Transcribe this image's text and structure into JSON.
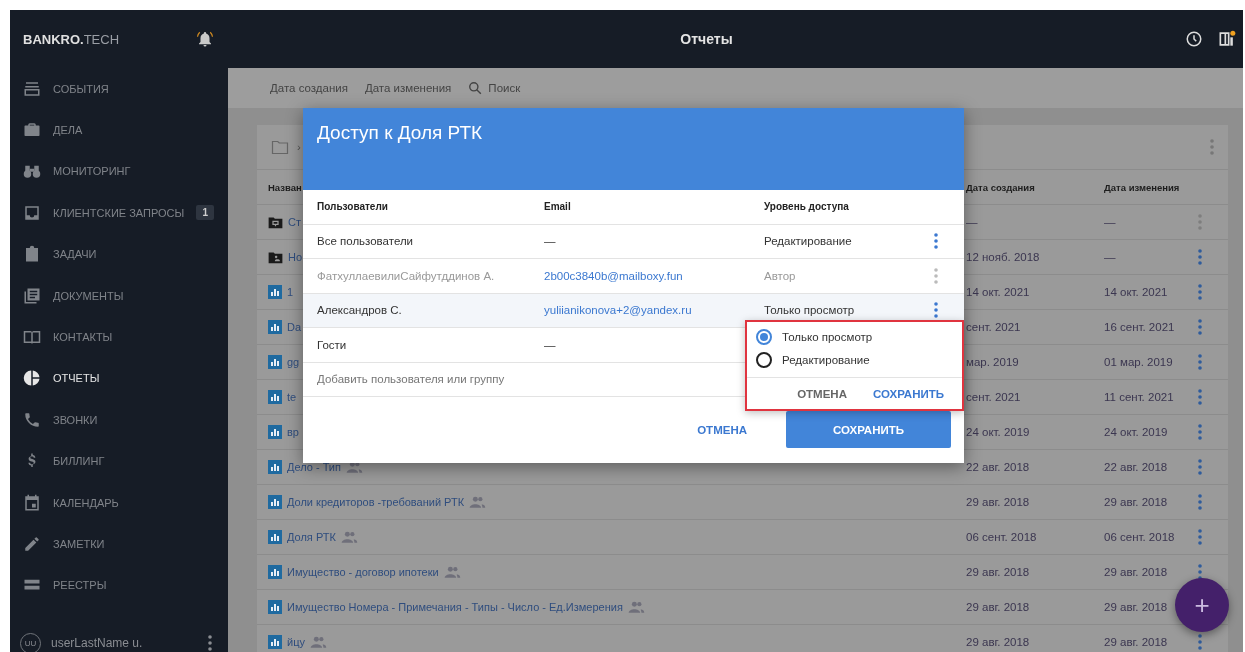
{
  "app": {
    "logo": "**BANKRO.**TECH",
    "title": "Отчеты"
  },
  "sidebar": {
    "items": [
      {
        "kind": "events",
        "label": "СОБЫТИЯ",
        "selected": false
      },
      {
        "kind": "cases",
        "label": "ДЕЛА",
        "selected": false
      },
      {
        "kind": "monitoring",
        "label": "МОНИТОРИНГ",
        "selected": false
      },
      {
        "kind": "inbox",
        "label": "КЛИЕНТСКИЕ ЗАПРОСЫ",
        "badge": "1",
        "selected": false
      },
      {
        "kind": "tasks",
        "label": "ЗАДАЧИ",
        "selected": false
      },
      {
        "kind": "documents",
        "label": "ДОКУМЕНТЫ",
        "selected": false
      },
      {
        "kind": "contacts",
        "label": "КОНТАКТЫ",
        "selected": false
      },
      {
        "kind": "reports",
        "label": "ОТЧЕТЫ",
        "selected": true
      },
      {
        "kind": "calls",
        "label": "ЗВОНКИ",
        "selected": false
      },
      {
        "kind": "billing",
        "label": "БИЛЛИНГ",
        "selected": false
      },
      {
        "kind": "calendar",
        "label": "КАЛЕНДАРЬ",
        "selected": false
      },
      {
        "kind": "notes",
        "label": "ЗАМЕТКИ",
        "selected": false
      },
      {
        "kind": "registers",
        "label": "РЕЕСТРЫ",
        "selected": false
      }
    ],
    "user": {
      "initials": "UU",
      "name": "userLastName u."
    }
  },
  "toolbar": {
    "sort_options": [
      "Дата создания",
      "Дата изменения"
    ],
    "search": "Поиск"
  },
  "breadcrumb": {
    "separator": "›"
  },
  "table": {
    "columns": [
      "Назван",
      "Дата создания",
      "Дата изменения"
    ],
    "rows": [
      {
        "kind": "folder-desktop",
        "name": "Ст",
        "shared": false,
        "created": "—",
        "modified": "—",
        "actions_disabled": true
      },
      {
        "kind": "folder-person",
        "name": "Но",
        "shared": false,
        "created": "12 нояб. 2018",
        "modified": "—",
        "actions_disabled": false
      },
      {
        "kind": "report",
        "name": "1",
        "shared": false,
        "created": "14 окт. 2021",
        "modified": "14 окт. 2021",
        "actions_disabled": false
      },
      {
        "kind": "report",
        "name": "Da",
        "shared": false,
        "created": "сент. 2021",
        "modified": "16 сент. 2021",
        "actions_disabled": false
      },
      {
        "kind": "report",
        "name": "gg",
        "shared": false,
        "created": "мар. 2019",
        "modified": "01 мар. 2019",
        "actions_disabled": false
      },
      {
        "kind": "report",
        "name": "te",
        "shared": false,
        "created": "сент. 2021",
        "modified": "11 сент. 2021",
        "actions_disabled": false
      },
      {
        "kind": "report",
        "name": "вр",
        "shared": false,
        "created": "24 окт. 2019",
        "modified": "24 окт. 2019",
        "actions_disabled": false
      },
      {
        "kind": "report",
        "name": "Дело - Тип",
        "shared": true,
        "created": "22 авг. 2018",
        "modified": "22 авг. 2018",
        "actions_disabled": false
      },
      {
        "kind": "report",
        "name": "Доли кредиторов -требований РТК",
        "shared": true,
        "created": "29 авг. 2018",
        "modified": "29 авг. 2018",
        "actions_disabled": false
      },
      {
        "kind": "report",
        "name": "Доля РТК",
        "shared": true,
        "created": "06 сент. 2018",
        "modified": "06 сент. 2018",
        "actions_disabled": false
      },
      {
        "kind": "report",
        "name": "Имущество - договор ипотеки",
        "shared": true,
        "created": "29 авг. 2018",
        "modified": "29 авг. 2018",
        "actions_disabled": false
      },
      {
        "kind": "report",
        "name": "Имущество Номера - Примечания - Типы - Число - Ед.Измерения",
        "shared": true,
        "created": "29 авг. 2018",
        "modified": "29 авг. 2018",
        "actions_disabled": false
      },
      {
        "kind": "report",
        "name": "йцу",
        "shared": true,
        "created": "29 авг. 2018",
        "modified": "29 авг. 2018",
        "actions_disabled": false
      }
    ]
  },
  "dialog": {
    "title": "Доступ к Доля РТК",
    "columns": [
      "Пользователи",
      "Email",
      "Уровень доступа"
    ],
    "rows": [
      {
        "kind": "group",
        "user": "Все пользователи",
        "email": "—",
        "level": "Редактирование",
        "disabled": false,
        "selected": false
      },
      {
        "kind": "user",
        "user": "ФатхуллаевилиСайфутддинов А.",
        "email": "2b00c3840b@mailboxy.fun",
        "level": "Автор",
        "disabled": true,
        "selected": false
      },
      {
        "kind": "user",
        "user": "Александров С.",
        "email": "yuliianikonova+2@yandex.ru",
        "level": "Только просмотр",
        "disabled": false,
        "selected": true
      },
      {
        "kind": "group",
        "user": "Гости",
        "email": "—",
        "disabled": false,
        "selected": false
      }
    ],
    "add_placeholder": "Добавить пользователя или группу",
    "cancel": "ОТМЕНА",
    "save": "СОХРАНИТЬ",
    "menu": {
      "options": [
        {
          "label": "Только просмотр",
          "selected": true
        },
        {
          "label": "Редактирование",
          "selected": false
        }
      ],
      "cancel": "ОТМЕНА",
      "save": "СОХРАНИТЬ"
    }
  },
  "fab": {
    "label": "+"
  }
}
